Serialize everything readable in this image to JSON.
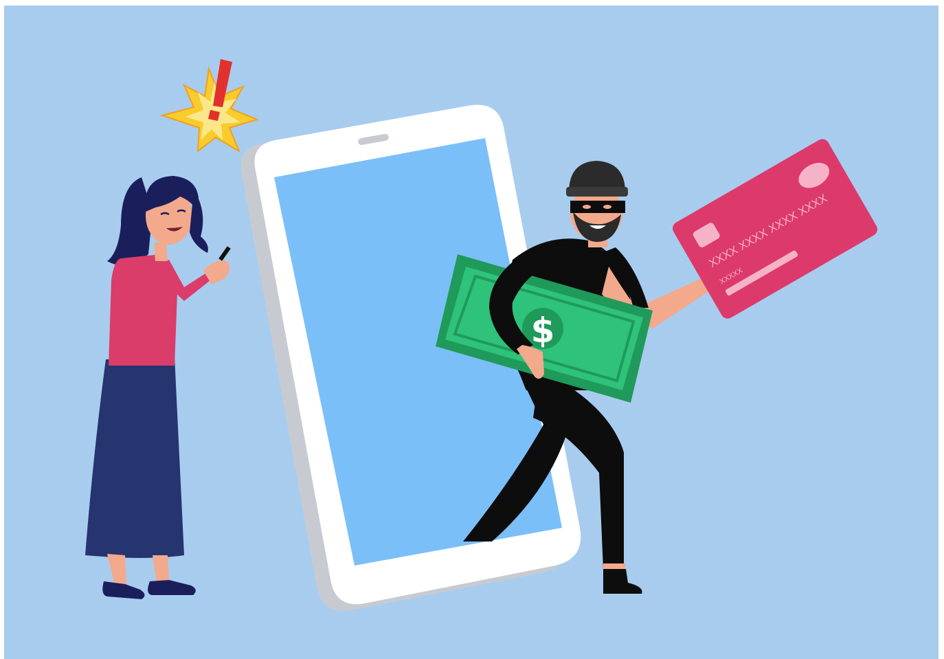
{
  "scene": {
    "description_free": true,
    "card": {
      "number": "XXXX XXXX XXXX XXXX",
      "name": "XXXXX"
    },
    "banknote": {
      "symbol": "$"
    },
    "alert": {
      "symbol": "!"
    }
  },
  "colors": {
    "background": "#a8ccee",
    "phone_screen": "#7bbff9",
    "phone_body": "#ffffff",
    "phone_shadow": "#c7cbd1",
    "card": "#dc3a6b",
    "banknote": "#2ec27a",
    "banknote_dark": "#1f9a5a",
    "thief_clothes": "#0d0d0d",
    "skin": "#f3a98b",
    "woman_sweater": "#da3d6a",
    "woman_skirt": "#263470",
    "woman_hair": "#1a1f5c",
    "alert_star": "#f7cc2c",
    "alert_mark": "#e2312d"
  }
}
